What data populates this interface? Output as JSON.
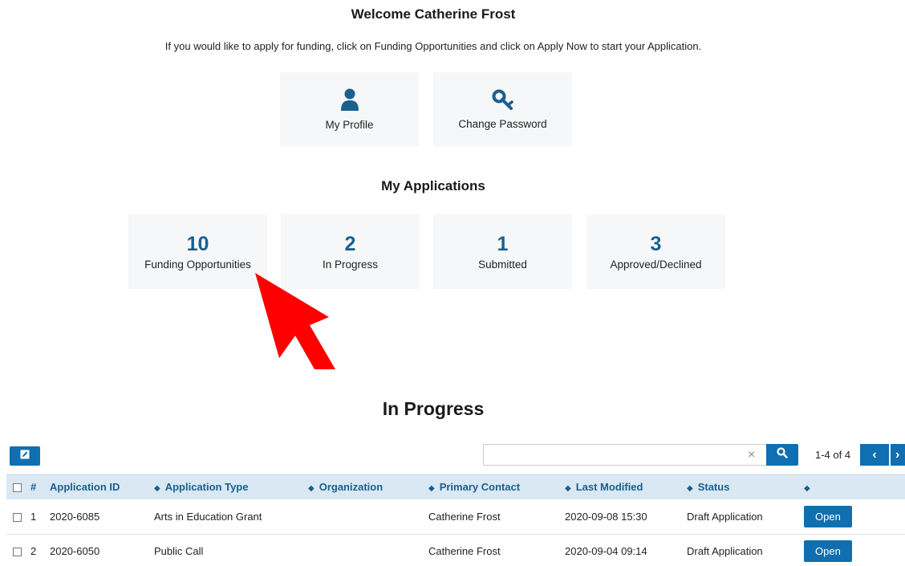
{
  "welcome": "Welcome Catherine Frost",
  "intro": "If you would like to apply for funding, click on Funding Opportunities and click on Apply Now to start your Application.",
  "quick_links": [
    {
      "label": "My Profile",
      "icon": "user-icon"
    },
    {
      "label": "Change Password",
      "icon": "key-icon"
    }
  ],
  "my_applications": {
    "title": "My Applications",
    "stats": [
      {
        "value": "10",
        "label": "Funding Opportunities"
      },
      {
        "value": "2",
        "label": "In Progress"
      },
      {
        "value": "1",
        "label": "Submitted"
      },
      {
        "value": "3",
        "label": "Approved/Declined"
      }
    ]
  },
  "in_progress": {
    "title": "In Progress",
    "search": {
      "value": "",
      "placeholder": ""
    },
    "pager": "1-4 of 4",
    "columns": [
      "#",
      "Application ID",
      "Application Type",
      "Organization",
      "Primary Contact",
      "Last Modified",
      "Status"
    ],
    "rows": [
      {
        "num": "1",
        "id": "2020-6085",
        "type": "Arts in Education Grant",
        "org": "",
        "contact": "Catherine Frost",
        "modified": "2020-09-08 15:30",
        "status": "Draft Application",
        "action": "Open"
      },
      {
        "num": "2",
        "id": "2020-6050",
        "type": "Public Call",
        "org": "",
        "contact": "Catherine Frost",
        "modified": "2020-09-04 09:14",
        "status": "Draft Application",
        "action": "Open"
      }
    ]
  },
  "colors": {
    "accent": "#0f6fb0",
    "stat_number": "#1b5f8f",
    "tile_bg": "#f6f7f8",
    "header_bg": "#d9e8f3",
    "arrow": "#ff0000"
  }
}
